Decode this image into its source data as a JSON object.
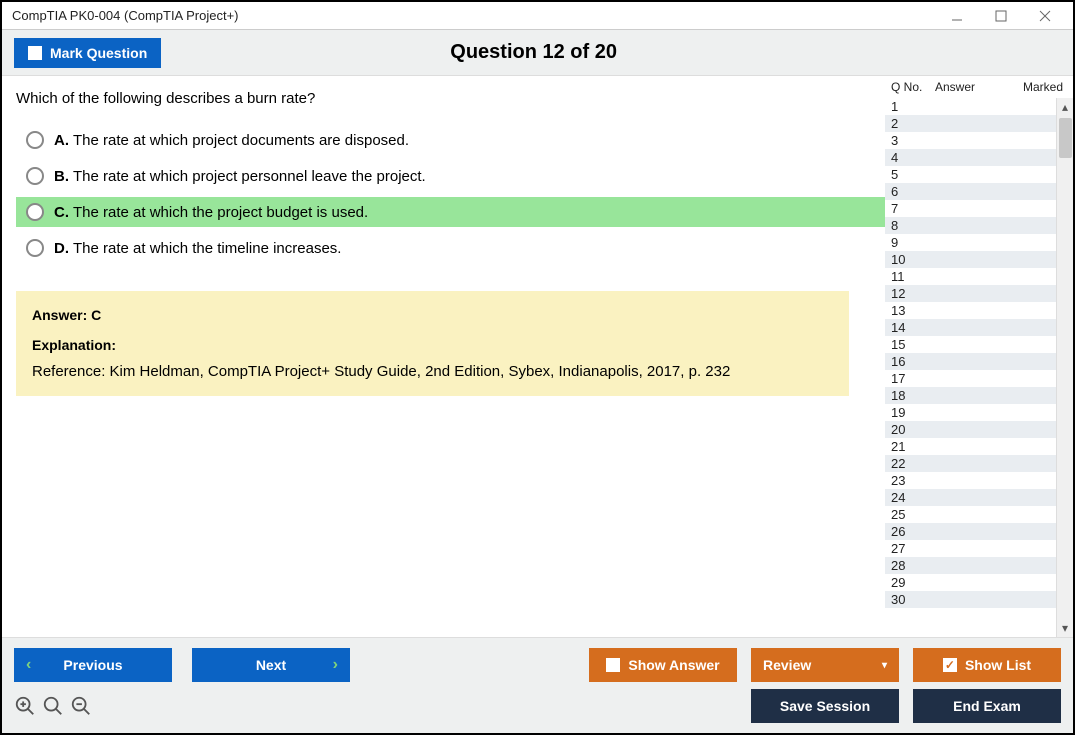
{
  "window": {
    "title": "CompTIA PK0-004 (CompTIA Project+)"
  },
  "header": {
    "mark_button": "Mark Question",
    "title": "Question 12 of 20"
  },
  "question": {
    "text": "Which of the following describes a burn rate?",
    "options": [
      {
        "letter": "A.",
        "text": "The rate at which project documents are disposed.",
        "highlighted": false
      },
      {
        "letter": "B.",
        "text": "The rate at which project personnel leave the project.",
        "highlighted": false
      },
      {
        "letter": "C.",
        "text": "The rate at which the project budget is used.",
        "highlighted": true
      },
      {
        "letter": "D.",
        "text": "The rate at which the timeline increases.",
        "highlighted": false
      }
    ]
  },
  "explanation": {
    "answer_line": "Answer: C",
    "heading": "Explanation:",
    "body": "Reference: Kim Heldman, CompTIA Project+ Study Guide, 2nd Edition, Sybex, Indianapolis, 2017, p. 232"
  },
  "side": {
    "cols": {
      "qno": "Q No.",
      "answer": "Answer",
      "marked": "Marked"
    },
    "rows": [
      1,
      2,
      3,
      4,
      5,
      6,
      7,
      8,
      9,
      10,
      11,
      12,
      13,
      14,
      15,
      16,
      17,
      18,
      19,
      20,
      21,
      22,
      23,
      24,
      25,
      26,
      27,
      28,
      29,
      30
    ]
  },
  "bottom": {
    "previous": "Previous",
    "next": "Next",
    "show_answer": "Show Answer",
    "review": "Review",
    "show_list": "Show List",
    "save_session": "Save Session",
    "end_exam": "End Exam"
  }
}
